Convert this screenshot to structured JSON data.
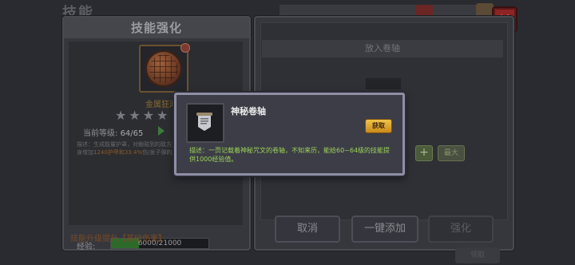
{
  "background": {
    "title": "技能",
    "close_symbol": "✕"
  },
  "left_panel": {
    "header": "技能强化",
    "skill_icon": "golden-shield-icon",
    "skill_name": "金属狂潮",
    "stars": "★★★★",
    "stars_filled": 4,
    "level_label": "当前等级:",
    "level_value": "64/65",
    "description_prefix": "描述：生成能量护罩，对触碰到的敌方造成伤害，",
    "description_mid": "技能每级，由身增加",
    "description_hl": "1240护甲和33.4%",
    "description_end": "伤/发子弹的射率，持续10秒。",
    "xp_label": "经验:",
    "xp_text": "6000/21000",
    "xp_current": 6000,
    "xp_max": 21000,
    "upgrade_text": "技能升级提升【基础伤害】"
  },
  "right_panel": {
    "scroll_header": "放入卷轴",
    "plus_label": "+",
    "max_label": "最大",
    "buttons": {
      "cancel": "取消",
      "quick_add": "一键添加",
      "enhance": "强化"
    },
    "bottom_stub": "领取"
  },
  "popup": {
    "item_icon": "scroll-icon",
    "item_name": "神秘卷轴",
    "get_label": "获取",
    "description": "描述：一页记载着神秘咒文的卷轴，不知来历，能给60~64级的技能提供1000经验值。"
  },
  "colors": {
    "popup_desc": "#9ed35a",
    "get_button": "#e0a830",
    "close_button": "#8e2323",
    "xp_fill": "#2d6a2a"
  }
}
